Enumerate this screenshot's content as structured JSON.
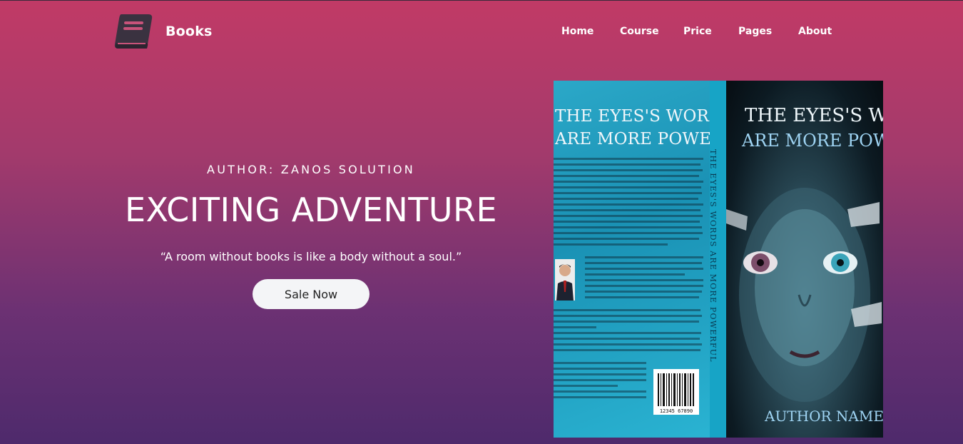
{
  "brand": {
    "name": "Books",
    "icon": "book-icon"
  },
  "nav": {
    "items": [
      "Home",
      "Course",
      "Price",
      "Pages",
      "About"
    ]
  },
  "hero": {
    "author": "AUTHOR: ZANOS SOLUTION",
    "headline": "EXCITING ADVENTURE",
    "quote": "“A room without books is like a body without a soul.”",
    "cta_label": "Sale Now"
  },
  "book": {
    "back_title_line1": "THE EYES'S WORDS",
    "back_title_line2": "ARE MORE POWERFUL",
    "spine_title": "THE EYES'S WORDS ARE MORE POWERFUL",
    "front_title_line1": "THE EYES'S WORDS",
    "front_title_line2": "ARE MORE POWERFUL",
    "author_name": "AUTHOR NAME",
    "barcode_number": "12345 67890"
  },
  "colors": {
    "background_top": "#c13a66",
    "background_bottom": "#4e2a6c",
    "cta_background": "#f4f5f7"
  }
}
